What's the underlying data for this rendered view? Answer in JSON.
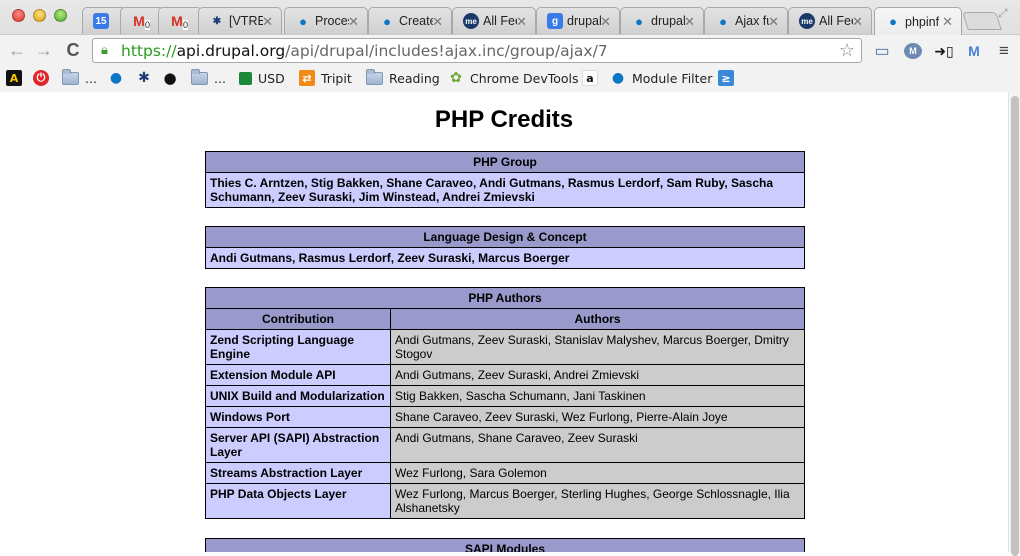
{
  "browser": {
    "tabs": [
      {
        "label": "",
        "icon": "google-calendar-icon",
        "icon_text": "15",
        "closable": false
      },
      {
        "label": "",
        "icon": "gmail-icon",
        "badge": "0",
        "closable": false
      },
      {
        "label": "",
        "icon": "gmail-icon",
        "badge": "0",
        "closable": false
      },
      {
        "label": "[VTRE",
        "icon": "jira-icon",
        "closable": true
      },
      {
        "label": "Proces",
        "icon": "drupal-icon",
        "closable": true
      },
      {
        "label": "Create",
        "icon": "drupal-icon",
        "closable": true
      },
      {
        "label": "All Fee",
        "icon": "me-icon",
        "closable": true
      },
      {
        "label": "drupal",
        "icon": "google-search-icon",
        "closable": true
      },
      {
        "label": "drupal",
        "icon": "drupal-icon",
        "closable": true
      },
      {
        "label": "Ajax fu",
        "icon": "drupal-icon",
        "closable": true
      },
      {
        "label": "All Fee",
        "icon": "me-icon",
        "closable": true
      },
      {
        "label": "phpinf",
        "icon": "drupal-icon",
        "closable": true,
        "active": true
      }
    ],
    "close_glyph": "✕",
    "url": {
      "scheme": "https://",
      "host": "api.drupal.org",
      "path": "/api/drupal/includes!ajax.inc/group/ajax/7"
    },
    "nav": {
      "back": "←",
      "forward": "→",
      "reload": "C"
    },
    "extensions": [
      "presentation-icon",
      "mightytext-icon",
      "phone-sync-icon",
      "gmail-m-icon",
      "menu-icon"
    ],
    "bookmarks": [
      {
        "label": "",
        "icon": "a-logo-icon"
      },
      {
        "label": "",
        "icon": "power-icon"
      },
      {
        "label": "...",
        "icon": "folder-icon"
      },
      {
        "label": "",
        "icon": "drupal-icon"
      },
      {
        "label": "",
        "icon": "jira-icon"
      },
      {
        "label": "",
        "icon": "github-icon"
      },
      {
        "label": "...",
        "icon": "folder-icon"
      },
      {
        "label": "USD",
        "icon": "chart-icon"
      },
      {
        "label": "Tripit",
        "icon": "tripit-icon"
      },
      {
        "label": "Reading",
        "icon": "folder-icon"
      },
      {
        "label": "Chrome DevTools",
        "icon": "devtools-icon"
      },
      {
        "label": "",
        "icon": "amazon-icon"
      },
      {
        "label": "Module Filter",
        "icon": "drupal-icon"
      },
      {
        "label": "",
        "icon": "bookmarklet-icon"
      }
    ]
  },
  "page": {
    "title": "PHP Credits",
    "php_group": {
      "header": "PHP Group",
      "members": "Thies C. Arntzen, Stig Bakken, Shane Caraveo, Andi Gutmans, Rasmus Lerdorf, Sam Ruby, Sascha Schumann, Zeev Suraski, Jim Winstead, Andrei Zmievski"
    },
    "language_design": {
      "header": "Language Design & Concept",
      "members": "Andi Gutmans, Rasmus Lerdorf, Zeev Suraski, Marcus Boerger"
    },
    "php_authors": {
      "header": "PHP Authors",
      "columns": [
        "Contribution",
        "Authors"
      ],
      "rows": [
        {
          "contribution": "Zend Scripting Language Engine",
          "authors": "Andi Gutmans, Zeev Suraski, Stanislav Malyshev, Marcus Boerger, Dmitry Stogov"
        },
        {
          "contribution": "Extension Module API",
          "authors": "Andi Gutmans, Zeev Suraski, Andrei Zmievski"
        },
        {
          "contribution": "UNIX Build and Modularization",
          "authors": "Stig Bakken, Sascha Schumann, Jani Taskinen"
        },
        {
          "contribution": "Windows Port",
          "authors": "Shane Caraveo, Zeev Suraski, Wez Furlong, Pierre-Alain Joye"
        },
        {
          "contribution": "Server API (SAPI) Abstraction Layer",
          "authors": "Andi Gutmans, Shane Caraveo, Zeev Suraski"
        },
        {
          "contribution": "Streams Abstraction Layer",
          "authors": "Wez Furlong, Sara Golemon"
        },
        {
          "contribution": "PHP Data Objects Layer",
          "authors": "Wez Furlong, Marcus Boerger, Sterling Hughes, George Schlossnagle, Ilia Alshanetsky"
        }
      ]
    },
    "sapi_modules": {
      "header": "SAPI Modules"
    }
  },
  "colors": {
    "table_header": "#9999cc",
    "table_label_cell": "#ccccff",
    "table_value_cell": "#cccccc"
  }
}
